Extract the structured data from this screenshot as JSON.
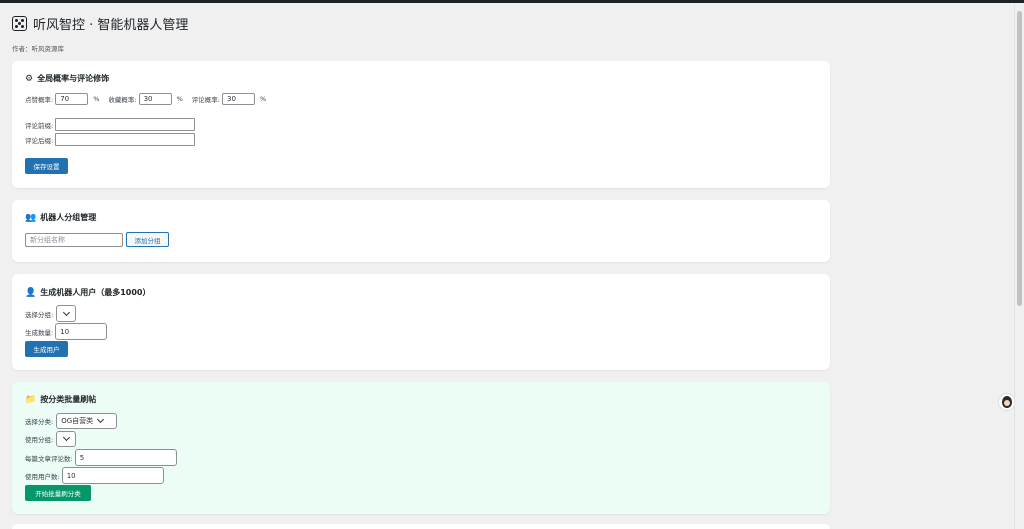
{
  "header": {
    "title": "听风智控 · 智能机器人管理",
    "author": "作者：听风资源库"
  },
  "global": {
    "title": "全局概率与评论修饰",
    "like_label": "点赞概率:",
    "like_value": "70",
    "fav_label": "收藏概率:",
    "fav_value": "30",
    "comment_label": "评论概率:",
    "comment_value": "30",
    "percent": "%",
    "prefix_label": "评论前缀:",
    "suffix_label": "评论后缀:",
    "save_label": "保存设置"
  },
  "groups": {
    "title": "机器人分组管理",
    "input_placeholder": "新分组名称",
    "add_label": "添加分组"
  },
  "users": {
    "title": "生成机器人用户（最多1000）",
    "group_label": "选择分组:",
    "count_label": "生成数量:",
    "count_value": "10",
    "generate_label": "生成用户"
  },
  "batch": {
    "title": "按分类批量刷帖",
    "category_label": "选择分类:",
    "category_value": "OG自营类",
    "group_label": "使用分组:",
    "comments_label": "每篇文章评论数:",
    "comments_value": "5",
    "users_label": "使用用户数:",
    "users_value": "10",
    "start_label": "开始批量刷分类"
  },
  "icons": {
    "header": "dice-icon",
    "global": "gear-icon",
    "groups": "users-group-icon",
    "users": "user-icon",
    "batch": "folder-icon",
    "chevron": "chevron-down-icon"
  },
  "colors": {
    "primary": "#2271b1",
    "green_button": "#059669",
    "green_panel": "#ecfdf5"
  }
}
